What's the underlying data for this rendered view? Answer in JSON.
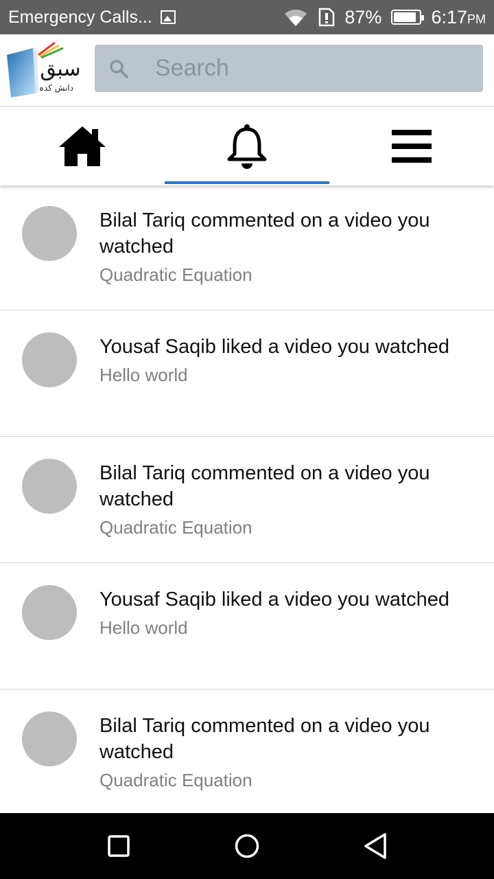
{
  "status_bar": {
    "carrier_text": "Emergency Calls...",
    "battery_percent": "87%",
    "battery_level": 0.87,
    "time": "6:17",
    "time_suffix": "PM"
  },
  "header": {
    "logo_text": "سبق",
    "logo_subtext": "دانش کدہ",
    "search_placeholder": "Search"
  },
  "tabs": [
    {
      "name": "home",
      "icon": "home-icon",
      "active": false
    },
    {
      "name": "notifications",
      "icon": "bell-icon",
      "active": true
    },
    {
      "name": "menu",
      "icon": "hamburger-icon",
      "active": false
    }
  ],
  "colors": {
    "accent": "#1e7bd8",
    "search_bg": "#bcc4ce",
    "avatar": "#bdbdbd",
    "status_bar": "#5f5f5f"
  },
  "notifications": [
    {
      "title": "Bilal Tariq commented on a video you watched",
      "subtitle": "Quadratic Equation"
    },
    {
      "title": "Yousaf Saqib liked a video you watched",
      "subtitle": "Hello world"
    },
    {
      "title": "Bilal Tariq commented on a video you watched",
      "subtitle": "Quadratic Equation"
    },
    {
      "title": "Yousaf Saqib liked a video you watched",
      "subtitle": "Hello world"
    },
    {
      "title": "Bilal Tariq commented on a video you watched",
      "subtitle": "Quadratic Equation"
    }
  ],
  "nav_bar": {
    "buttons": [
      "recents-icon",
      "home-circle-icon",
      "back-icon"
    ]
  }
}
